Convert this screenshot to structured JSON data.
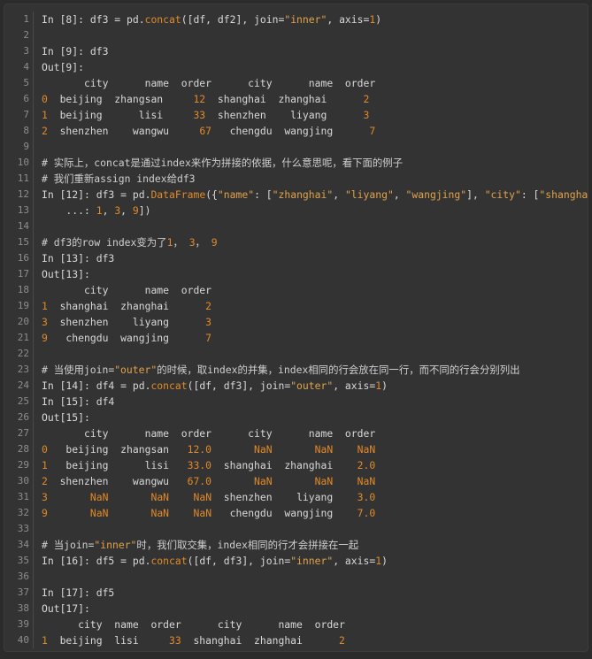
{
  "editor": {
    "line_numbers": [
      "1",
      "2",
      "3",
      "4",
      "5",
      "6",
      "7",
      "8",
      "9",
      "10",
      "11",
      "12",
      "13",
      "14",
      "15",
      "16",
      "17",
      "18",
      "19",
      "20",
      "21",
      "22",
      "23",
      "24",
      "25",
      "26",
      "27",
      "28",
      "29",
      "30",
      "31",
      "32",
      "33",
      "34",
      "35",
      "36",
      "37",
      "38",
      "39",
      "40"
    ],
    "lines": [
      [
        {
          "t": "In [8]: df3 = pd.",
          "c": "plain"
        },
        {
          "t": "concat",
          "c": "func"
        },
        {
          "t": "([df, df2], join=",
          "c": "plain"
        },
        {
          "t": "\"inner\"",
          "c": "str"
        },
        {
          "t": ", axis=",
          "c": "plain"
        },
        {
          "t": "1",
          "c": "num"
        },
        {
          "t": ")",
          "c": "plain"
        }
      ],
      [],
      [
        {
          "t": "In [9]: df3",
          "c": "plain"
        }
      ],
      [
        {
          "t": "Out[9]:",
          "c": "plain"
        }
      ],
      [
        {
          "t": "       city      name  order      city      name  order",
          "c": "plain"
        }
      ],
      [
        {
          "t": "0",
          "c": "num"
        },
        {
          "t": "  beijing  zhangsan     ",
          "c": "plain"
        },
        {
          "t": "12",
          "c": "num"
        },
        {
          "t": "  shanghai  zhanghai      ",
          "c": "plain"
        },
        {
          "t": "2",
          "c": "num"
        }
      ],
      [
        {
          "t": "1",
          "c": "num"
        },
        {
          "t": "  beijing      lisi     ",
          "c": "plain"
        },
        {
          "t": "33",
          "c": "num"
        },
        {
          "t": "  shenzhen    liyang      ",
          "c": "plain"
        },
        {
          "t": "3",
          "c": "num"
        }
      ],
      [
        {
          "t": "2",
          "c": "num"
        },
        {
          "t": "  shenzhen    wangwu     ",
          "c": "plain"
        },
        {
          "t": "67",
          "c": "num"
        },
        {
          "t": "   chengdu  wangjing      ",
          "c": "plain"
        },
        {
          "t": "7",
          "c": "num"
        }
      ],
      [],
      [
        {
          "t": "# 实际上，concat是通过index来作为拼接的依据，什么意思呢，看下面的例子",
          "c": "comment"
        }
      ],
      [
        {
          "t": "# 我们重新assign index给df3",
          "c": "comment"
        }
      ],
      [
        {
          "t": "In [12]: df3 = pd.",
          "c": "plain"
        },
        {
          "t": "DataFrame",
          "c": "func"
        },
        {
          "t": "({",
          "c": "plain"
        },
        {
          "t": "\"name\"",
          "c": "str"
        },
        {
          "t": ": [",
          "c": "plain"
        },
        {
          "t": "\"zhanghai\"",
          "c": "str"
        },
        {
          "t": ", ",
          "c": "plain"
        },
        {
          "t": "\"liyang\"",
          "c": "str"
        },
        {
          "t": ", ",
          "c": "plain"
        },
        {
          "t": "\"wangjing\"",
          "c": "str"
        },
        {
          "t": "], ",
          "c": "plain"
        },
        {
          "t": "\"city\"",
          "c": "str"
        },
        {
          "t": ": [",
          "c": "plain"
        },
        {
          "t": "\"shanghai\"",
          "c": "str"
        },
        {
          "t": ",",
          "c": "plain"
        }
      ],
      [
        {
          "t": "    ...: ",
          "c": "plain"
        },
        {
          "t": "1",
          "c": "num"
        },
        {
          "t": ", ",
          "c": "plain"
        },
        {
          "t": "3",
          "c": "num"
        },
        {
          "t": ", ",
          "c": "plain"
        },
        {
          "t": "9",
          "c": "num"
        },
        {
          "t": "])",
          "c": "plain"
        }
      ],
      [],
      [
        {
          "t": "# df3的row index变为了",
          "c": "comment"
        },
        {
          "t": "1",
          "c": "num"
        },
        {
          "t": "， ",
          "c": "comment"
        },
        {
          "t": "3",
          "c": "num"
        },
        {
          "t": "， ",
          "c": "comment"
        },
        {
          "t": "9",
          "c": "num"
        }
      ],
      [
        {
          "t": "In [13]: df3",
          "c": "plain"
        }
      ],
      [
        {
          "t": "Out[13]:",
          "c": "plain"
        }
      ],
      [
        {
          "t": "       city      name  order",
          "c": "plain"
        }
      ],
      [
        {
          "t": "1",
          "c": "num"
        },
        {
          "t": "  shanghai  zhanghai      ",
          "c": "plain"
        },
        {
          "t": "2",
          "c": "num"
        }
      ],
      [
        {
          "t": "3",
          "c": "num"
        },
        {
          "t": "  shenzhen    liyang      ",
          "c": "plain"
        },
        {
          "t": "3",
          "c": "num"
        }
      ],
      [
        {
          "t": "9",
          "c": "num"
        },
        {
          "t": "   chengdu  wangjing      ",
          "c": "plain"
        },
        {
          "t": "7",
          "c": "num"
        }
      ],
      [],
      [
        {
          "t": "# 当使用join=",
          "c": "comment"
        },
        {
          "t": "\"outer\"",
          "c": "str"
        },
        {
          "t": "的时候，取index的并集，index相同的行会放在同一行，而不同的行会分别列出",
          "c": "comment"
        }
      ],
      [
        {
          "t": "In [14]: df4 = pd.",
          "c": "plain"
        },
        {
          "t": "concat",
          "c": "func"
        },
        {
          "t": "([df, df3], join=",
          "c": "plain"
        },
        {
          "t": "\"outer\"",
          "c": "str"
        },
        {
          "t": ", axis=",
          "c": "plain"
        },
        {
          "t": "1",
          "c": "num"
        },
        {
          "t": ")",
          "c": "plain"
        }
      ],
      [
        {
          "t": "In [15]: df4",
          "c": "plain"
        }
      ],
      [
        {
          "t": "Out[15]:",
          "c": "plain"
        }
      ],
      [
        {
          "t": "       city      name  order      city      name  order",
          "c": "plain"
        }
      ],
      [
        {
          "t": "0",
          "c": "num"
        },
        {
          "t": "   beijing  zhangsan   ",
          "c": "plain"
        },
        {
          "t": "12.0",
          "c": "num"
        },
        {
          "t": "       ",
          "c": "plain"
        },
        {
          "t": "NaN",
          "c": "nan"
        },
        {
          "t": "       ",
          "c": "plain"
        },
        {
          "t": "NaN",
          "c": "nan"
        },
        {
          "t": "    ",
          "c": "plain"
        },
        {
          "t": "NaN",
          "c": "nan"
        }
      ],
      [
        {
          "t": "1",
          "c": "num"
        },
        {
          "t": "   beijing      lisi   ",
          "c": "plain"
        },
        {
          "t": "33.0",
          "c": "num"
        },
        {
          "t": "  shanghai  zhanghai    ",
          "c": "plain"
        },
        {
          "t": "2.0",
          "c": "num"
        }
      ],
      [
        {
          "t": "2",
          "c": "num"
        },
        {
          "t": "  shenzhen    wangwu   ",
          "c": "plain"
        },
        {
          "t": "67.0",
          "c": "num"
        },
        {
          "t": "       ",
          "c": "plain"
        },
        {
          "t": "NaN",
          "c": "nan"
        },
        {
          "t": "       ",
          "c": "plain"
        },
        {
          "t": "NaN",
          "c": "nan"
        },
        {
          "t": "    ",
          "c": "plain"
        },
        {
          "t": "NaN",
          "c": "nan"
        }
      ],
      [
        {
          "t": "3",
          "c": "num"
        },
        {
          "t": "       ",
          "c": "plain"
        },
        {
          "t": "NaN",
          "c": "nan"
        },
        {
          "t": "       ",
          "c": "plain"
        },
        {
          "t": "NaN",
          "c": "nan"
        },
        {
          "t": "    ",
          "c": "plain"
        },
        {
          "t": "NaN",
          "c": "nan"
        },
        {
          "t": "  shenzhen    liyang    ",
          "c": "plain"
        },
        {
          "t": "3.0",
          "c": "num"
        }
      ],
      [
        {
          "t": "9",
          "c": "num"
        },
        {
          "t": "       ",
          "c": "plain"
        },
        {
          "t": "NaN",
          "c": "nan"
        },
        {
          "t": "       ",
          "c": "plain"
        },
        {
          "t": "NaN",
          "c": "nan"
        },
        {
          "t": "    ",
          "c": "plain"
        },
        {
          "t": "NaN",
          "c": "nan"
        },
        {
          "t": "   chengdu  wangjing    ",
          "c": "plain"
        },
        {
          "t": "7.0",
          "c": "num"
        }
      ],
      [],
      [
        {
          "t": "# 当join=",
          "c": "comment"
        },
        {
          "t": "\"inner\"",
          "c": "str"
        },
        {
          "t": "时，我们取交集，index相同的行才会拼接在一起",
          "c": "comment"
        }
      ],
      [
        {
          "t": "In [16]: df5 = pd.",
          "c": "plain"
        },
        {
          "t": "concat",
          "c": "func"
        },
        {
          "t": "([df, df3], join=",
          "c": "plain"
        },
        {
          "t": "\"inner\"",
          "c": "str"
        },
        {
          "t": ", axis=",
          "c": "plain"
        },
        {
          "t": "1",
          "c": "num"
        },
        {
          "t": ")",
          "c": "plain"
        }
      ],
      [],
      [
        {
          "t": "In [17]: df5",
          "c": "plain"
        }
      ],
      [
        {
          "t": "Out[17]:",
          "c": "plain"
        }
      ],
      [
        {
          "t": "      city  name  order      city      name  order",
          "c": "plain"
        }
      ],
      [
        {
          "t": "1",
          "c": "num"
        },
        {
          "t": "  beijing  lisi     ",
          "c": "plain"
        },
        {
          "t": "33",
          "c": "num"
        },
        {
          "t": "  shanghai  zhanghai      ",
          "c": "plain"
        },
        {
          "t": "2",
          "c": "num"
        }
      ]
    ]
  }
}
